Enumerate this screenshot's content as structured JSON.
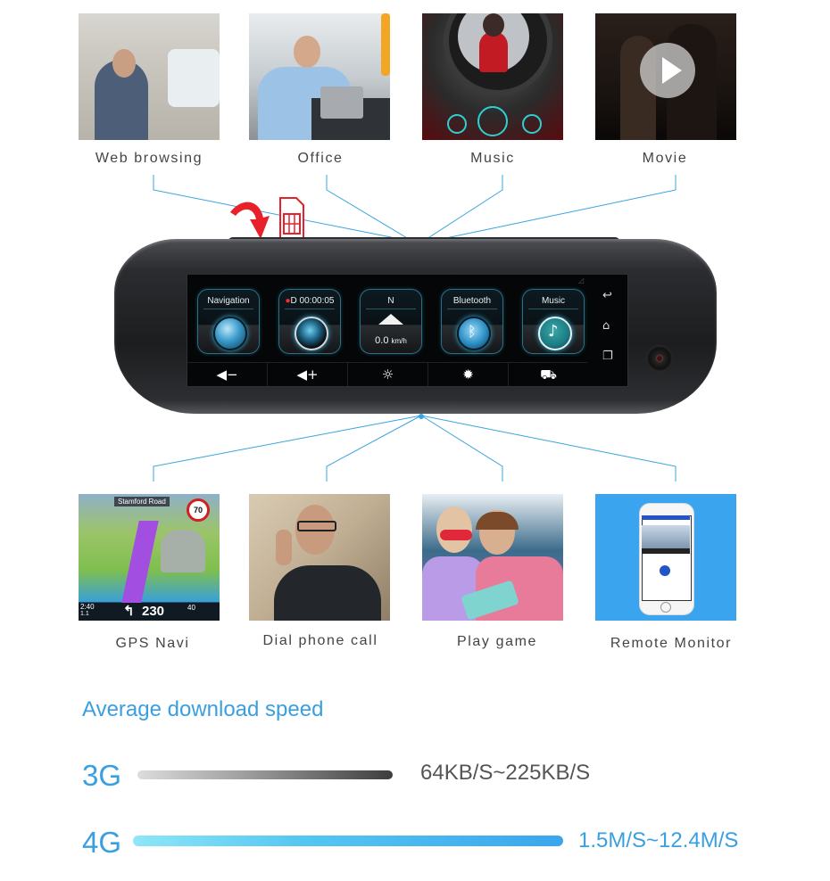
{
  "top_features": [
    {
      "label": "Web browsing",
      "image": "man-using-phone-in-car"
    },
    {
      "label": "Office",
      "image": "man-with-tablet-in-car"
    },
    {
      "label": "Music",
      "image": "music-player-app"
    },
    {
      "label": "Movie",
      "image": "movie-with-play-button"
    }
  ],
  "bottom_features": [
    {
      "label": "GPS Navi",
      "image": "gps-navigation-map"
    },
    {
      "label": "Dial phone call",
      "image": "man-on-phone-call"
    },
    {
      "label": "Play game",
      "image": "kids-with-tablet"
    },
    {
      "label": "Remote Monitor",
      "image": "phone-remote-app"
    }
  ],
  "gps_tile": {
    "street": "Stamford Road",
    "speed_limit": "70",
    "distance": "230",
    "time": "2:40",
    "dist_left": "1.1",
    "speed": "40"
  },
  "device": {
    "apps": [
      {
        "label": "Navigation",
        "icon": "globe-plane-icon"
      },
      {
        "label": "D 00:00:05",
        "icon": "camera-lens-icon",
        "recording": true
      },
      {
        "label": "N",
        "icon": "compass-arrow-icon",
        "speed_value": "0.0",
        "speed_unit": "km/h"
      },
      {
        "label": "Bluetooth",
        "icon": "bluetooth-icon"
      },
      {
        "label": "Music",
        "icon": "music-note-icon"
      }
    ],
    "bottom_bar": [
      {
        "name": "volume-down",
        "glyph": "◀−"
      },
      {
        "name": "volume-up",
        "glyph": "◀+"
      },
      {
        "name": "brightness-down",
        "glyph": "☼"
      },
      {
        "name": "brightness-up",
        "glyph": "✹"
      },
      {
        "name": "car-mode",
        "glyph": "🚘"
      }
    ],
    "side_nav": [
      {
        "name": "back",
        "glyph": "↩"
      },
      {
        "name": "home",
        "glyph": "⌂"
      },
      {
        "name": "recents",
        "glyph": "❐"
      }
    ]
  },
  "speed_section": {
    "title": "Average download speed",
    "rows": [
      {
        "gen": "3G",
        "range": "64KB/S~225KB/S",
        "color": "#555555"
      },
      {
        "gen": "4G",
        "range": "1.5M/S~12.4M/S",
        "color": "#3a9fe0"
      }
    ]
  },
  "colors": {
    "accent_blue": "#3a9fe0",
    "line_blue": "#3aa3e0",
    "sim_red": "#e8202a",
    "remote_bg": "#3aa4ee"
  }
}
